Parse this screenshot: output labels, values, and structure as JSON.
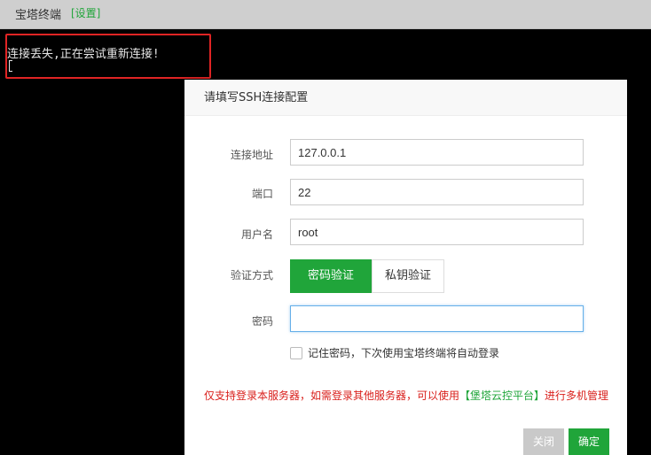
{
  "titlebar": {
    "title": "宝塔终端",
    "settings": "[设置]"
  },
  "terminal": {
    "message": "连接丢失,正在尝试重新连接!"
  },
  "dialog": {
    "title": "请填写SSH连接配置",
    "host_label": "连接地址",
    "host_value": "127.0.0.1",
    "port_label": "端口",
    "port_value": "22",
    "user_label": "用户名",
    "user_value": "root",
    "auth_label": "验证方式",
    "auth_password": "密码验证",
    "auth_key": "私钥验证",
    "password_label": "密码",
    "password_value": "",
    "remember": "记住密码，下次使用宝塔终端将自动登录",
    "notice_prefix": "仅支持登录本服务器，如需登录其他服务器，可以使用",
    "notice_link": "【堡塔云控平台】",
    "notice_suffix": "进行多机管理",
    "close_button": "关闭",
    "confirm_button": "确定"
  },
  "colors": {
    "accent": "#20a53a",
    "warning": "#d9201c",
    "highlight": "#e02424"
  }
}
